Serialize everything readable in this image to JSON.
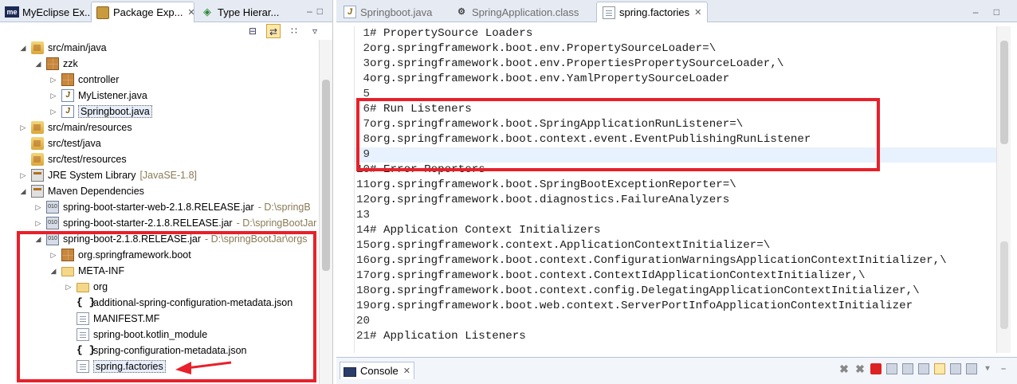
{
  "left_panel": {
    "tabs": [
      {
        "label": "MyEclipse Ex...",
        "icon": "myeclipse-icon"
      },
      {
        "label": "Package Exp...",
        "icon": "package-explorer-icon",
        "close": "✕"
      },
      {
        "label": "Type Hierar...",
        "icon": "type-hierarchy-icon"
      }
    ],
    "toolbar": [
      "collapse-all-icon",
      "link-with-editor-icon",
      "view-menu-icon",
      "chevron-down-icon"
    ],
    "tree": [
      {
        "label": "src/main/java",
        "icon": "source-folder-icon",
        "twisty": "◢",
        "indent": 1
      },
      {
        "label": "zzk",
        "icon": "package-icon",
        "twisty": "◢",
        "indent": 2
      },
      {
        "label": "controller",
        "icon": "package-icon",
        "twisty": "▷",
        "indent": 3
      },
      {
        "label": "MyListener.java",
        "icon": "java-file-icon",
        "twisty": "▷",
        "indent": 3
      },
      {
        "label": "Springboot.java",
        "icon": "java-file-icon",
        "twisty": "▷",
        "indent": 3,
        "selected": true
      },
      {
        "label": "src/main/resources",
        "icon": "source-folder-icon",
        "twisty": "▷",
        "indent": 1
      },
      {
        "label": "src/test/java",
        "icon": "source-folder-icon",
        "twisty": "",
        "indent": 1
      },
      {
        "label": "src/test/resources",
        "icon": "source-folder-icon",
        "twisty": "",
        "indent": 1
      },
      {
        "label": "JRE System Library",
        "decoration": "[JavaSE-1.8]",
        "icon": "library-icon",
        "twisty": "▷",
        "indent": 1
      },
      {
        "label": "Maven Dependencies",
        "icon": "library-icon",
        "twisty": "◢",
        "indent": 1
      },
      {
        "label": "spring-boot-starter-web-2.1.8.RELEASE.jar",
        "decoration": "- D:\\springB",
        "icon": "jar-icon",
        "twisty": "▷",
        "indent": 2
      },
      {
        "label": "spring-boot-starter-2.1.8.RELEASE.jar",
        "decoration": "- D:\\springBootJar",
        "icon": "jar-icon",
        "twisty": "▷",
        "indent": 2
      },
      {
        "label": "spring-boot-2.1.8.RELEASE.jar",
        "decoration": "- D:\\springBootJar\\orgs",
        "icon": "jar-icon",
        "twisty": "◢",
        "indent": 2
      },
      {
        "label": "org.springframework.boot",
        "icon": "package-icon",
        "twisty": "▷",
        "indent": 3
      },
      {
        "label": "META-INF",
        "icon": "folder-icon",
        "twisty": "◢",
        "indent": 3
      },
      {
        "label": "org",
        "icon": "folder-icon",
        "twisty": "▷",
        "indent": 4
      },
      {
        "label": "additional-spring-configuration-metadata.json",
        "icon": "json-file-icon",
        "twisty": "",
        "indent": 4
      },
      {
        "label": "MANIFEST.MF",
        "icon": "text-file-icon",
        "twisty": "",
        "indent": 4
      },
      {
        "label": "spring-boot.kotlin_module",
        "icon": "text-file-icon",
        "twisty": "",
        "indent": 4
      },
      {
        "label": "spring-configuration-metadata.json",
        "icon": "json-file-icon",
        "twisty": "",
        "indent": 4
      },
      {
        "label": "spring.factories",
        "icon": "text-file-icon",
        "twisty": "",
        "indent": 4,
        "selected": true
      }
    ]
  },
  "editor": {
    "tabs": [
      {
        "label": "Springboot.java",
        "icon": "java-file-icon",
        "active": false
      },
      {
        "label": "SpringApplication.class",
        "icon": "class-file-icon",
        "active": false
      },
      {
        "label": "spring.factories",
        "icon": "text-file-icon",
        "active": true,
        "close": "✕"
      }
    ],
    "window_controls": "– □",
    "lines": [
      "# PropertySource Loaders",
      "org.springframework.boot.env.PropertySourceLoader=\\",
      "org.springframework.boot.env.PropertiesPropertySourceLoader,\\",
      "org.springframework.boot.env.YamlPropertySourceLoader",
      "",
      "# Run Listeners",
      "org.springframework.boot.SpringApplicationRunListener=\\",
      "org.springframework.boot.context.event.EventPublishingRunListener",
      "",
      "# Error Reporters",
      "org.springframework.boot.SpringBootExceptionReporter=\\",
      "org.springframework.boot.diagnostics.FailureAnalyzers",
      "",
      "# Application Context Initializers",
      "org.springframework.context.ApplicationContextInitializer=\\",
      "org.springframework.boot.context.ConfigurationWarningsApplicationContextInitializer,\\",
      "org.springframework.boot.context.ContextIdApplicationContextInitializer,\\",
      "org.springframework.boot.context.config.DelegatingApplicationContextInitializer,\\",
      "org.springframework.boot.web.context.ServerPortInfoApplicationContextInitializer",
      "",
      "# Application Listeners"
    ],
    "current_line": 9
  },
  "console": {
    "tab_label": "Console",
    "close": "✕",
    "tools": [
      "remove-launch-icon",
      "remove-all-icon",
      "terminate-icon",
      "clear-console-icon",
      "scroll-lock-icon",
      "word-wrap-icon",
      "pin-console-icon",
      "open-console-icon",
      "display-selected-icon",
      "view-menu-icon",
      "minimize-icon"
    ]
  },
  "annotation_color": "#e8202a"
}
